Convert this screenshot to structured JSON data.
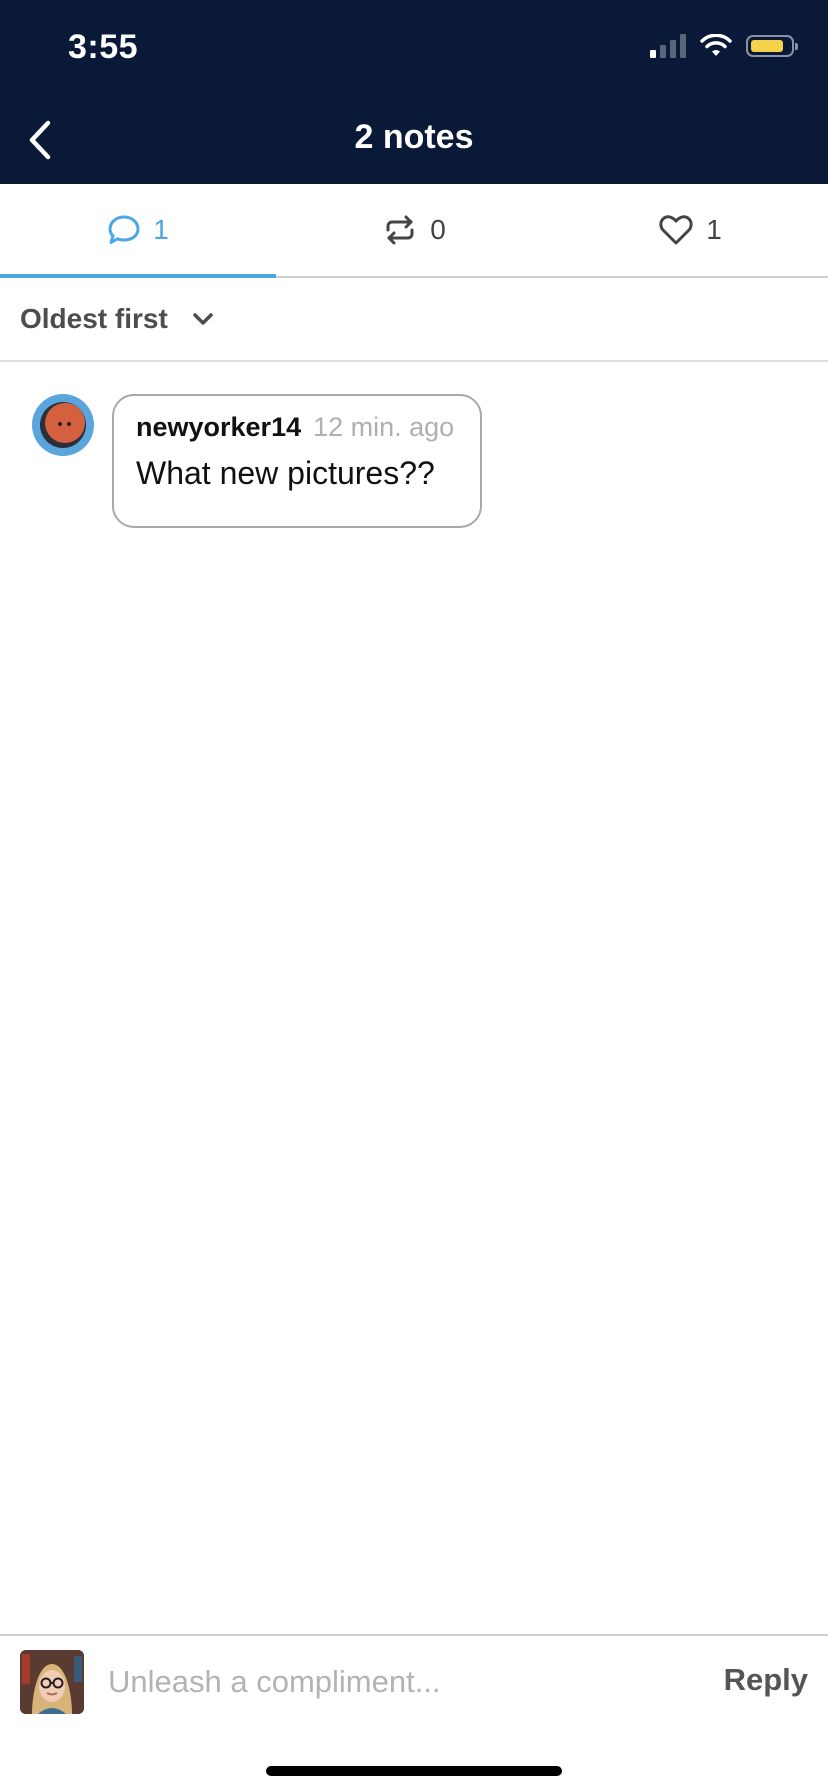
{
  "status_bar": {
    "time": "3:55"
  },
  "nav": {
    "title": "2 notes",
    "back_icon": "chevron-left-icon"
  },
  "tabs": [
    {
      "icon": "comment-icon",
      "count": "1",
      "active": true
    },
    {
      "icon": "reblog-icon",
      "count": "0",
      "active": false
    },
    {
      "icon": "heart-icon",
      "count": "1",
      "active": false
    }
  ],
  "sort": {
    "label": "Oldest first",
    "icon": "chevron-down-icon"
  },
  "comments": [
    {
      "username": "newyorker14",
      "timestamp": "12 min. ago",
      "text": "What new pictures??"
    }
  ],
  "composer": {
    "placeholder": "Unleash a compliment...",
    "reply_label": "Reply"
  },
  "colors": {
    "header_bg": "#0a1937",
    "accent": "#4aa7e6",
    "battery": "#f5d24a"
  }
}
